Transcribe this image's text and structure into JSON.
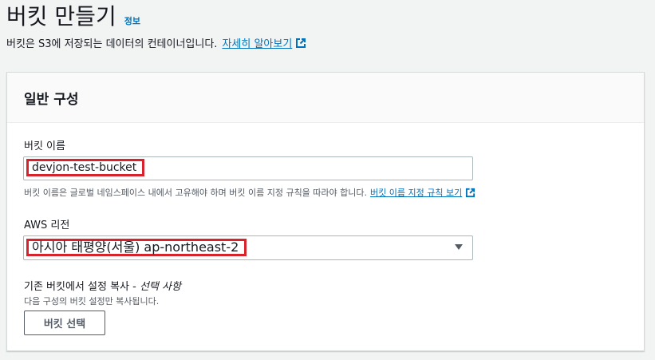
{
  "header": {
    "title": "버킷 만들기",
    "info_link": "정보",
    "description": "버킷은 S3에 저장되는 데이터의 컨테이너입니다.",
    "learn_more": "자세히 알아보기"
  },
  "panel": {
    "title": "일반 구성",
    "bucket_name": {
      "label": "버킷 이름",
      "value": "devjon-test-bucket",
      "hint": "버킷 이름은 글로벌 네임스페이스 내에서 고유해야 하며 버킷 이름 지정 규칙을 따라야 합니다.",
      "hint_link": "버킷 이름 지정 규칙 보기"
    },
    "region": {
      "label": "AWS 리전",
      "value": "아시아 태평양(서울) ap-northeast-2"
    },
    "copy_settings": {
      "label": "기존 버킷에서 설정 복사 - ",
      "label_optional": "선택 사항",
      "hint": "다음 구성의 버킷 설정만 복사됩니다.",
      "button": "버킷 선택"
    }
  },
  "colors": {
    "link": "#0073bb",
    "highlight": "#d6232c"
  }
}
